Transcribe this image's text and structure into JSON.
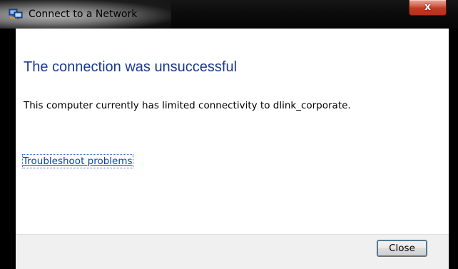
{
  "window": {
    "title": "Connect to a Network",
    "close_glyph": "x"
  },
  "main": {
    "heading": "The connection was unsuccessful",
    "message": "This computer currently has limited connectivity to dlink_corporate.",
    "troubleshoot_link": "Troubleshoot problems"
  },
  "footer": {
    "close_label": "Close"
  },
  "icons": {
    "title_icon": "network-icon",
    "close_icon": "close-icon"
  },
  "colors": {
    "heading": "#1c3a8c",
    "link": "#0645ad",
    "close_button_red": "#c13a22"
  }
}
